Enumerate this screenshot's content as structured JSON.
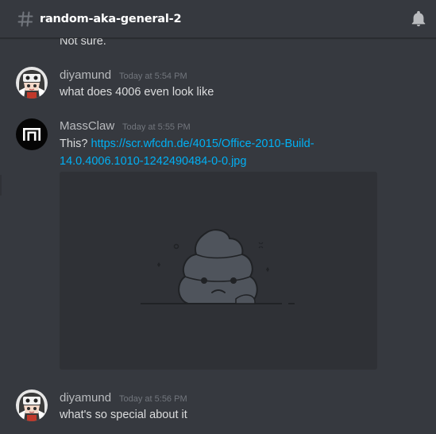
{
  "header": {
    "channel_name": "random-aka-general-2"
  },
  "messages": [
    {
      "partial": true,
      "text": "Not sure."
    },
    {
      "author": "diyamund",
      "timestamp": "Today at 5:54 PM",
      "text": "what does 4006 even look like"
    },
    {
      "author": "MassClaw",
      "timestamp": "Today at 5:55 PM",
      "text_prefix": "This? ",
      "link_line1": "https://scr.wfcdn.de/4015/Office-2010-Build-",
      "link_line2": "14.0.4006.1010-1242490484-0-0.jpg",
      "attachment": "broken-image-placeholder"
    },
    {
      "author": "diyamund",
      "timestamp": "Today at 5:56 PM",
      "text": "what's so special about it"
    }
  ],
  "colors": {
    "background": "#36393f",
    "embed_background": "#2f3136",
    "link": "#00b0f4",
    "username": "#b9bbbe",
    "timestamp": "#72767d",
    "message_text": "#dcddde"
  }
}
